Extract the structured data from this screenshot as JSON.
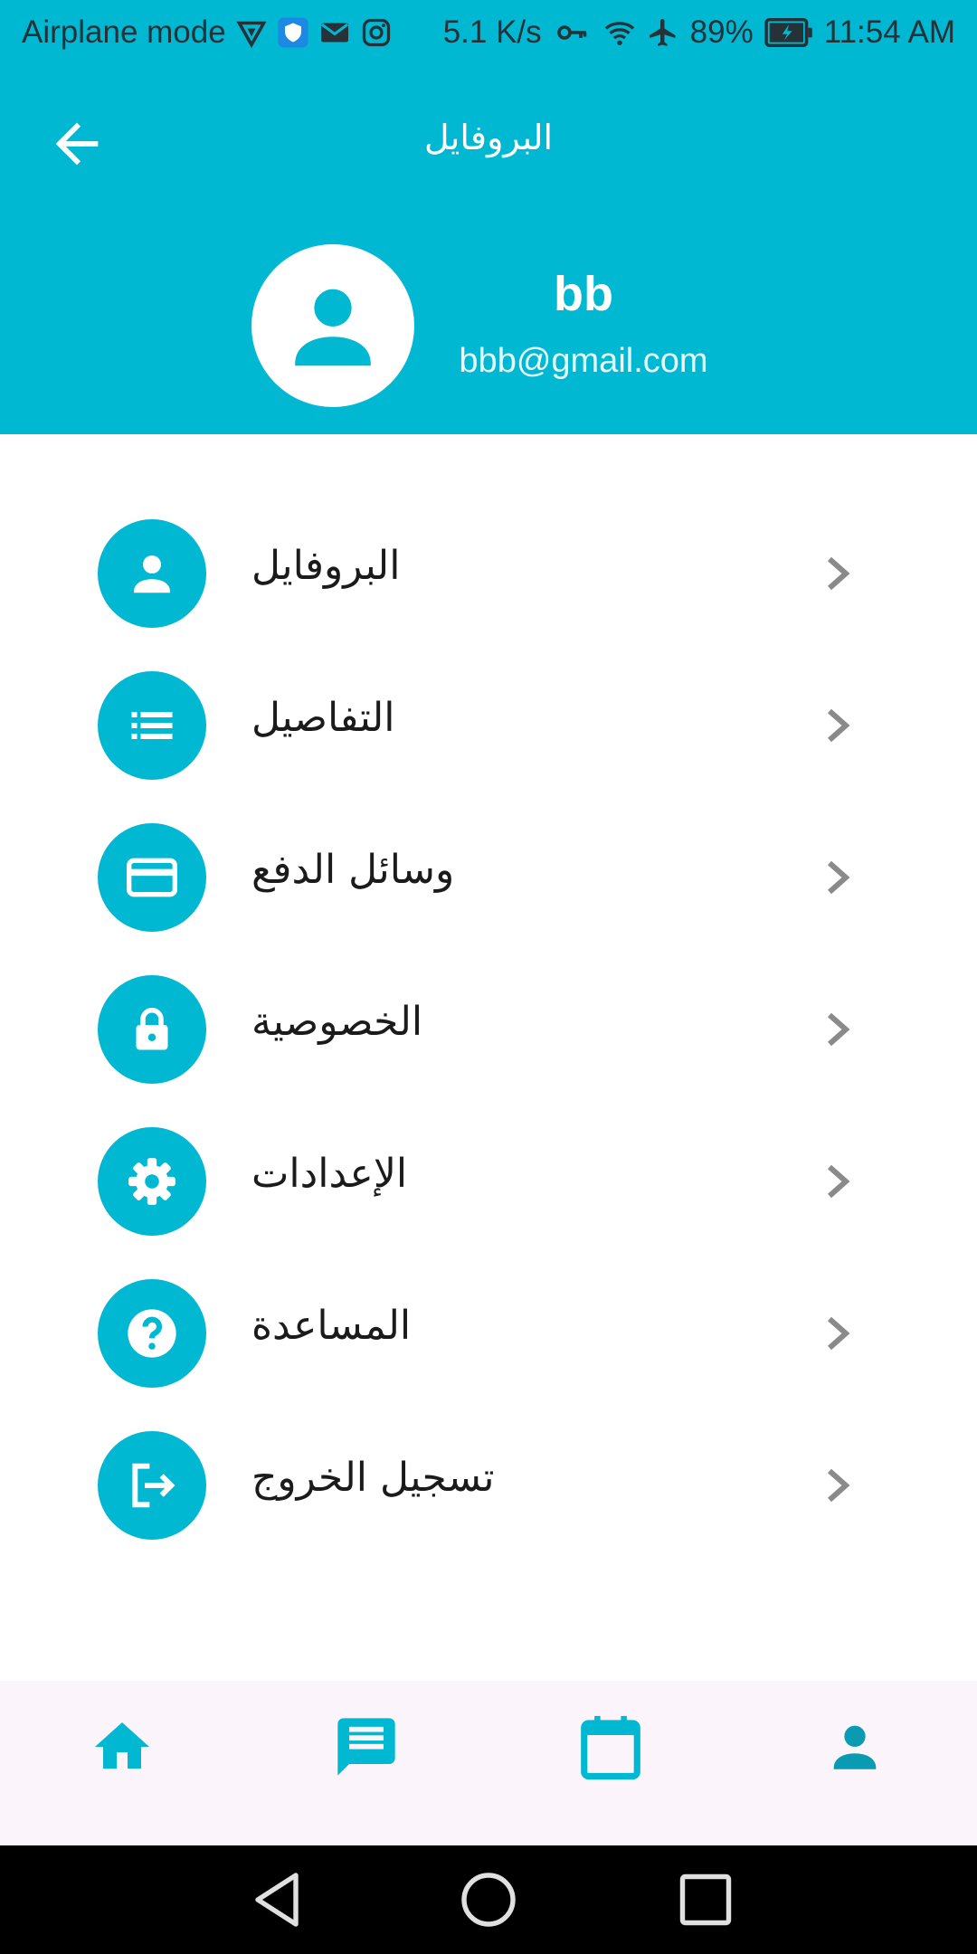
{
  "status_bar": {
    "left_text": "Airplane mode",
    "speed": "5.1 K/s",
    "battery": "89%",
    "time": "11:54 AM",
    "icons_left": [
      "vpn-icon",
      "shield-icon",
      "mail-icon",
      "instagram-icon"
    ],
    "icons_right": [
      "key-icon",
      "wifi-icon",
      "airplane-icon",
      "battery-icon"
    ]
  },
  "header": {
    "title": "البروفايل",
    "back_icon": "arrow-left-icon"
  },
  "profile": {
    "name": "bb",
    "email": "bbb@gmail.com",
    "avatar_icon": "person-icon"
  },
  "menu": {
    "items": [
      {
        "label": "البروفايل",
        "icon": "person-icon"
      },
      {
        "label": "التفاصيل",
        "icon": "list-icon"
      },
      {
        "label": "وسائل الدفع",
        "icon": "credit-card-icon"
      },
      {
        "label": "الخصوصية",
        "icon": "lock-icon"
      },
      {
        "label": "الإعدادات",
        "icon": "gear-icon"
      },
      {
        "label": "المساعدة",
        "icon": "help-icon"
      },
      {
        "label": "تسجيل الخروج",
        "icon": "logout-icon"
      }
    ]
  },
  "bottom_nav": {
    "items": [
      "home-icon",
      "chat-icon",
      "calendar-icon",
      "profile-icon"
    ]
  },
  "system_nav": {
    "items": [
      "back-triangle-icon",
      "home-circle-icon",
      "recents-square-icon"
    ]
  },
  "colors": {
    "primary": "#01B8D3",
    "bottom_nav_bg": "#FBF5FB",
    "chevron": "#8a8a8a",
    "text": "#1b1b1b"
  }
}
